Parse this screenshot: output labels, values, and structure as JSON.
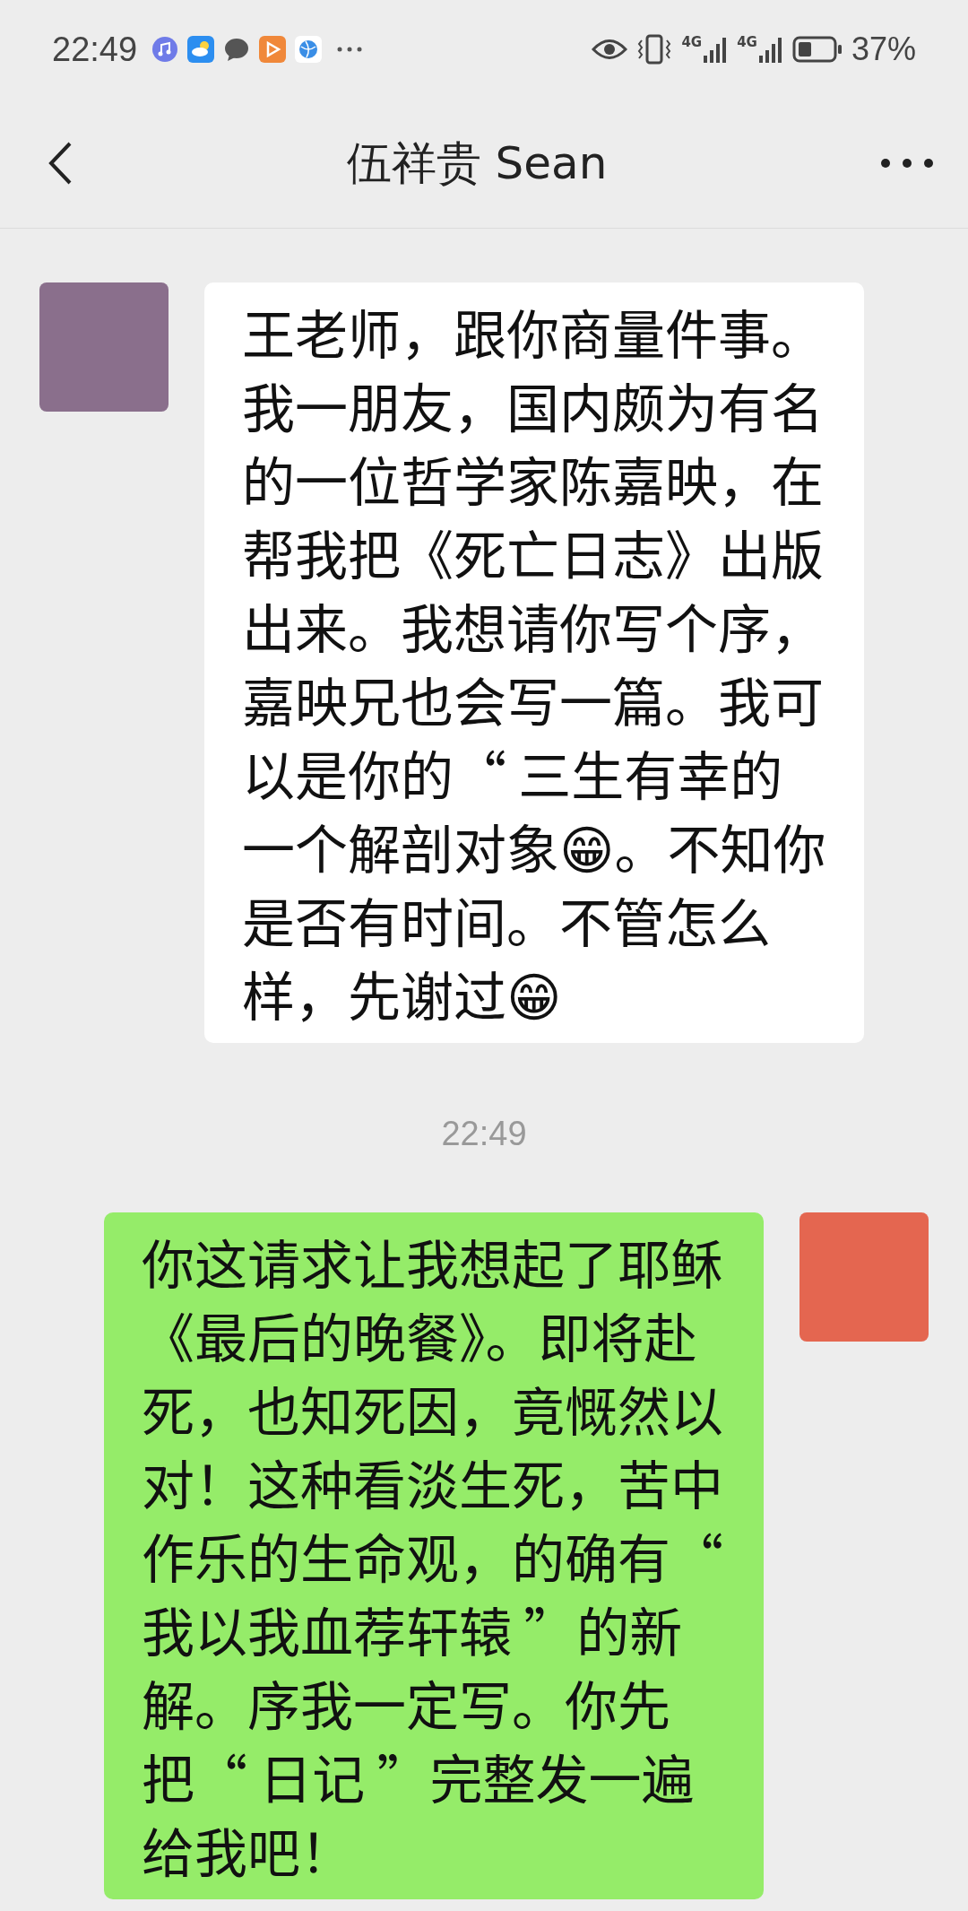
{
  "status_bar": {
    "time": "22:49",
    "network_labels": [
      "4G",
      "4G"
    ],
    "battery": "37%"
  },
  "header": {
    "title": "伍祥贵 Sean"
  },
  "messages": [
    {
      "kind": "incoming",
      "text": "王老师，跟你商量件事。我一朋友，国内颇为有名的一位哲学家陈嘉映，在帮我把《死亡日志》出版出来。我想请你写个序，嘉映兄也会写一篇。我可以是你的“ 三生有幸的一个解剖对象😁。不知你是否有时间。不管怎么样，先谢过😁"
    },
    {
      "kind": "time",
      "text": "22:49"
    },
    {
      "kind": "outgoing",
      "text": "你这请求让我想起了耶稣《最后的晚餐》。即将赴死，也知死因，竟慨然以对！这种看淡生死，苦中作乐的生命观，的确有“ 我以我血荐轩辕 ”的新解。序我一定写。你先把“ 日记 ”完整发一遍给我吧！"
    }
  ]
}
